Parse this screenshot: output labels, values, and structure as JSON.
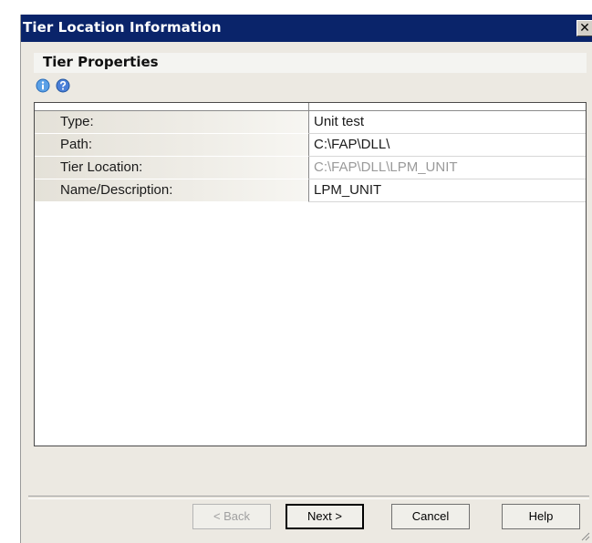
{
  "window": {
    "title": "Tier Location Information",
    "close_label": "✕"
  },
  "section": {
    "title": "Tier Properties"
  },
  "toolbar": {
    "icons": [
      "info-icon",
      "help-icon"
    ]
  },
  "properties": [
    {
      "name": "Type:",
      "value": "Unit test",
      "editable": true
    },
    {
      "name": "Path:",
      "value": "C:\\FAP\\DLL\\",
      "editable": true
    },
    {
      "name": "Tier Location:",
      "value": "C:\\FAP\\DLL\\LPM_UNIT",
      "editable": false
    },
    {
      "name": "Name/Description:",
      "value": "LPM_UNIT",
      "editable": true
    }
  ],
  "buttons": {
    "back": "< Back",
    "next": "Next >",
    "cancel": "Cancel",
    "help": "Help"
  }
}
